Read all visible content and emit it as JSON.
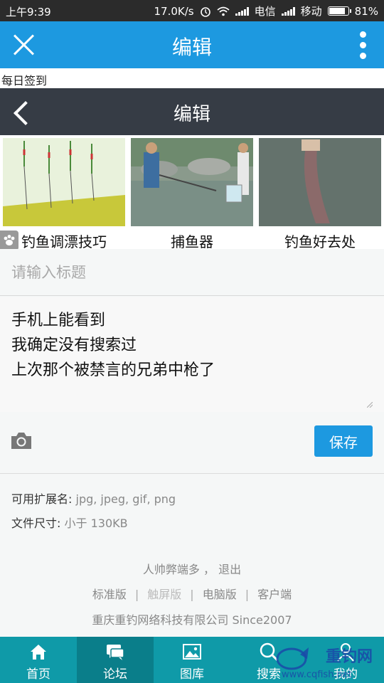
{
  "status_bar": {
    "time": "上午9:39",
    "speed": "17.0K/s",
    "carrier1": "电信",
    "carrier2": "移动",
    "battery": "81%"
  },
  "app_header": {
    "title": "编辑"
  },
  "daily_signin": "每日签到",
  "inner_header": {
    "title": "编辑"
  },
  "ads": [
    {
      "caption": "钓鱼调漂技巧"
    },
    {
      "caption": "捕鱼器"
    },
    {
      "caption": "钓鱼好去处"
    }
  ],
  "form": {
    "title_placeholder": "请输入标题",
    "body_lines": [
      "手机上能看到",
      "我确定没有搜索过",
      "上次那个被禁言的兄弟中枪了"
    ],
    "save_label": "保存"
  },
  "upload_info": {
    "ext_label": "可用扩展名:",
    "ext_value": "jpg, jpeg, gif, png",
    "size_label": "文件尺寸:",
    "size_value": "小于 130KB"
  },
  "footer": {
    "user_line": "人帅弊端多 ， 退出",
    "links": [
      "标准版",
      "触屏版",
      "电脑版",
      "客户端"
    ],
    "company": "重庆重钓网络科技有限公司 Since2007"
  },
  "bottom_nav": [
    {
      "label": "首页",
      "icon": "home-icon"
    },
    {
      "label": "论坛",
      "icon": "chat-icon"
    },
    {
      "label": "图库",
      "icon": "image-icon"
    },
    {
      "label": "搜索",
      "icon": "search-icon"
    },
    {
      "label": "我的",
      "icon": "user-icon"
    }
  ],
  "watermark": {
    "brand": "重钓网",
    "url": "www.cqfish.net"
  },
  "colors": {
    "app_bar": "#1d99e0",
    "inner_bar": "#363c45",
    "bottom_nav": "#0f9aa8",
    "save_button": "#1d99e0"
  }
}
